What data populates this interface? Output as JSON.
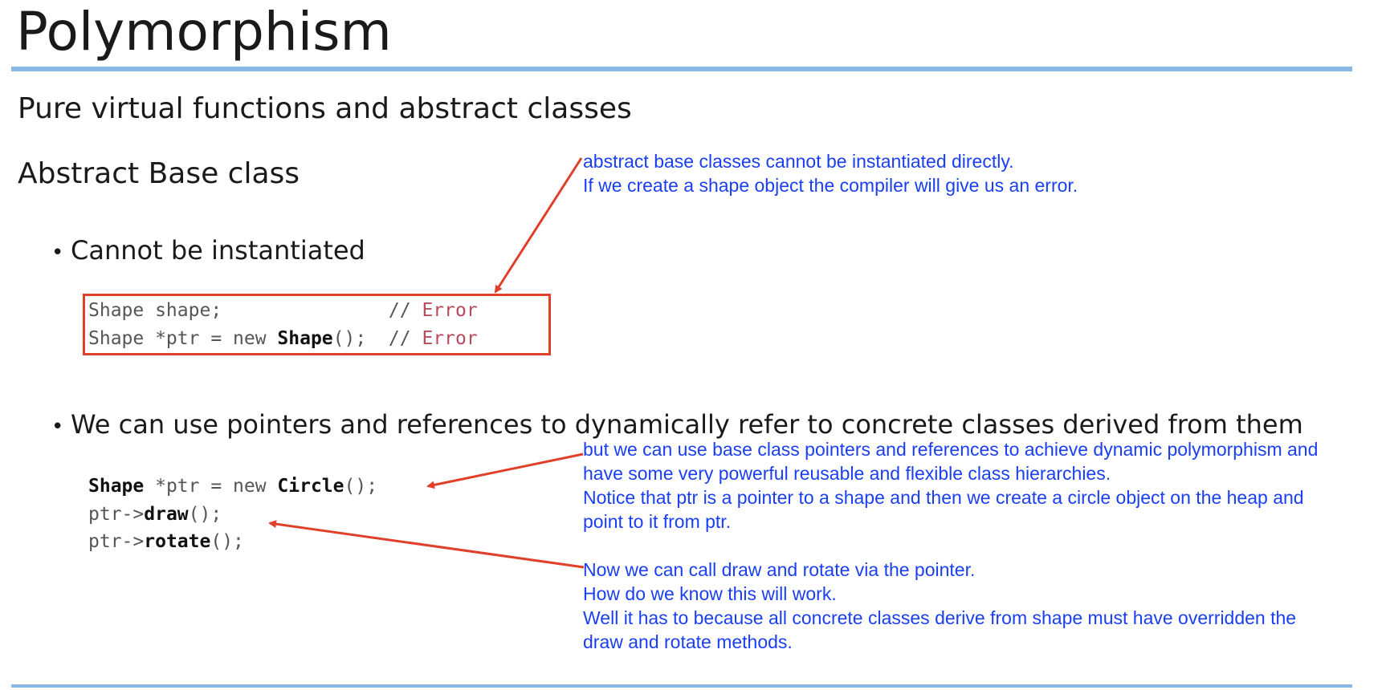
{
  "slide": {
    "title": "Polymorphism",
    "subtitle": "Pure virtual functions and abstract classes",
    "section": "Abstract Base class",
    "bullets": [
      "Cannot be instantiated",
      "We can use pointers and references to dynamically refer to concrete classes derived from them"
    ],
    "bullet_marker": "•"
  },
  "code_block_1": {
    "line1": {
      "a": "Shape shape;",
      "comment": "//",
      "err": "Error"
    },
    "line2": {
      "a": "Shape *ptr = new ",
      "bold": "Shape",
      "b": "();",
      "comment": "//",
      "err": "Error"
    }
  },
  "code_block_2": {
    "line1": {
      "bold1": "Shape",
      "a": " *ptr = new ",
      "bold2": "Circle",
      "b": "();"
    },
    "line2": {
      "a": "ptr->",
      "bold": "draw",
      "b": "();"
    },
    "line3": {
      "a": "ptr->",
      "bold": "rotate",
      "b": "();"
    }
  },
  "annotations": {
    "note1": "abstract base classes cannot be instantiated directly.\nIf we create a shape object the compiler will give us an error.",
    "note2": "but we can use base class pointers and references to achieve dynamic polymorphism and\nhave some very powerful reusable and flexible class hierarchies.\nNotice that ptr is a pointer to a shape and then we create a circle object on the heap and\npoint to it from ptr.",
    "note3": "Now we can call draw and rotate via the pointer.\nHow do we know this will work.\nWell it has to because all concrete classes derive from shape must have overridden the\ndraw and rotate methods."
  },
  "colors": {
    "accent_rule": "#8ab8e6",
    "annotation_text": "#1a3ff0",
    "arrow": "#e0402a",
    "error_text": "#b84a5c"
  }
}
